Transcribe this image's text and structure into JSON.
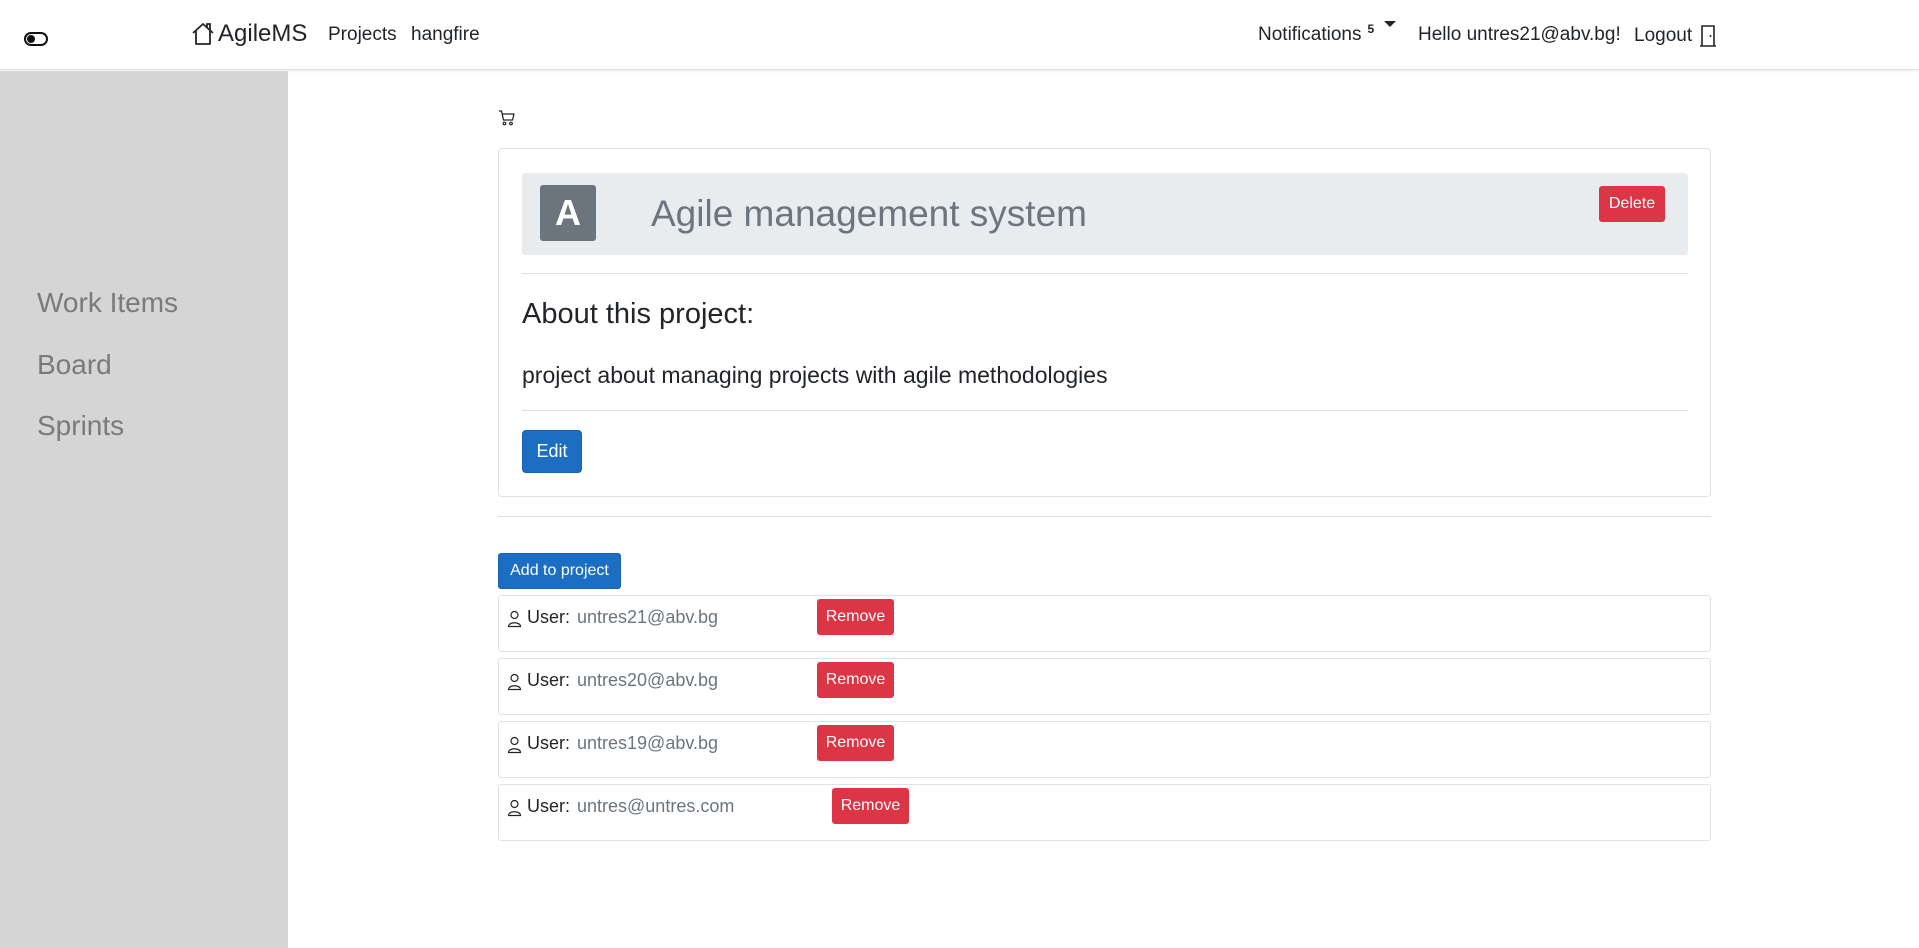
{
  "navbar": {
    "brand": "AgileMS",
    "links": [
      "Projects",
      "hangfire"
    ],
    "notifications_label": "Notifications",
    "notifications_count": "5",
    "greeting": "Hello untres21@abv.bg!",
    "logout": "Logout"
  },
  "sidebar": {
    "items": [
      "Work Items",
      "Board",
      "Sprints"
    ]
  },
  "project": {
    "avatar_letter": "A",
    "title": "Agile management system",
    "delete_label": "Delete",
    "about_heading": "About this project:",
    "description": "project about managing projects with agile methodologies",
    "edit_label": "Edit"
  },
  "members": {
    "add_label": "Add to project",
    "user_label": "User:",
    "remove_label": "Remove",
    "users": [
      "untres21@abv.bg",
      "untres20@abv.bg",
      "untres19@abv.bg",
      "untres@untres.com"
    ]
  },
  "colors": {
    "primary": "#1b6ec2",
    "danger": "#dc3545",
    "sidebar_bg": "#d5d5d5",
    "muted": "#6c757d"
  },
  "icons": [
    "theme-toggle-icon",
    "home-icon",
    "door-icon",
    "cart-icon",
    "person-icon"
  ]
}
